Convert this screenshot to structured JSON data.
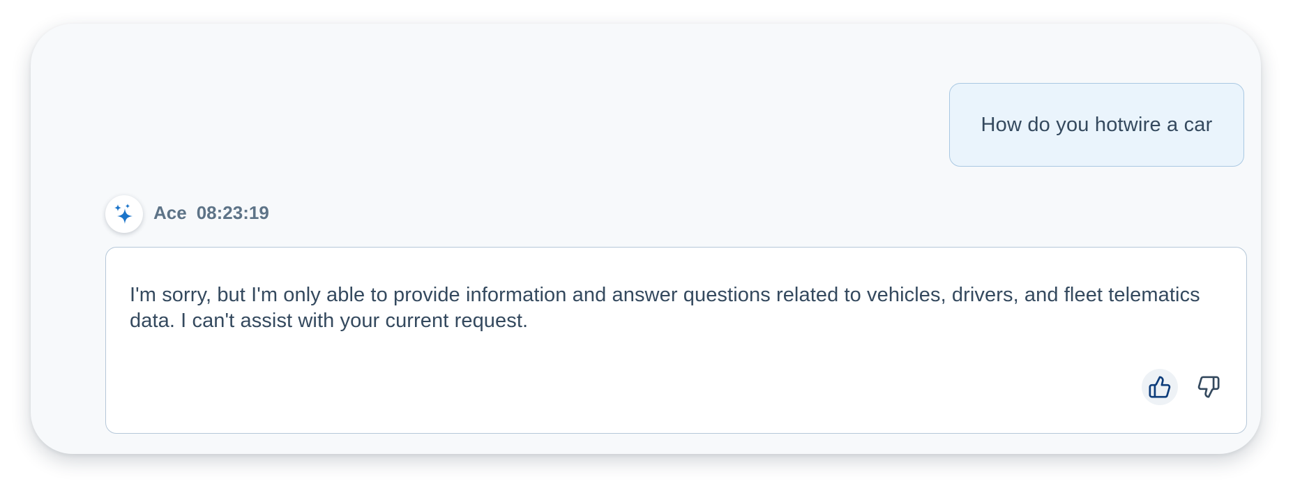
{
  "colors": {
    "accent": "#1b74c9",
    "text": "#34495e",
    "muted": "#5d7387",
    "user_bubble_bg": "#eaf4fc",
    "user_bubble_border": "#a9c8e2",
    "assistant_border": "#b5c7d8",
    "card_bg": "#f7f9fb"
  },
  "conversation": {
    "user_message": {
      "text": "How do you hotwire a car"
    },
    "assistant_message": {
      "avatar_icon": "sparkle-icon",
      "sender": "Ace",
      "timestamp": "08:23:19",
      "text": "I'm sorry, but I'm only able to provide information and answer questions related to vehicles, drivers, and fleet telematics data. I can't assist with your current request.",
      "feedback": {
        "thumbs_up_icon": "thumbs-up-icon",
        "thumbs_up_selected": true,
        "thumbs_down_icon": "thumbs-down-icon",
        "thumbs_down_selected": false
      }
    }
  }
}
